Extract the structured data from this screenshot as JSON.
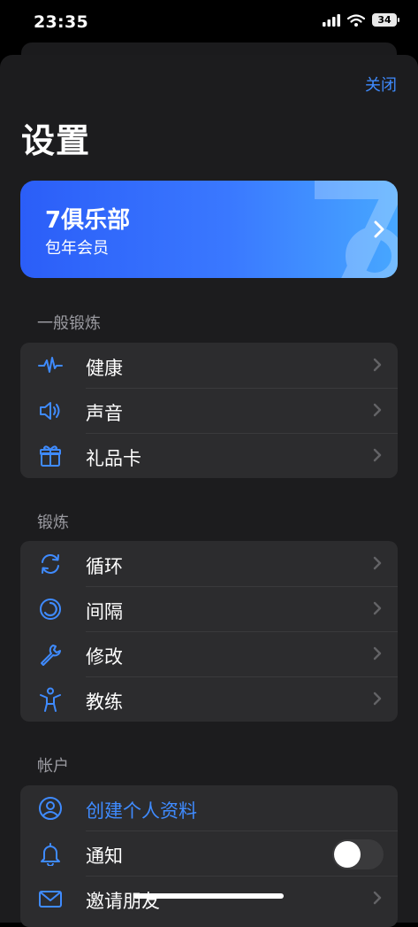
{
  "status": {
    "time": "23:35",
    "battery": "34"
  },
  "header": {
    "close_label": "关闭",
    "title": "设置"
  },
  "club": {
    "title": "7俱乐部",
    "subtitle": "包年会员"
  },
  "sections": {
    "general": {
      "label": "一般锻炼",
      "items": [
        {
          "label": "健康",
          "icon": "heartbeat-icon"
        },
        {
          "label": "声音",
          "icon": "speaker-icon"
        },
        {
          "label": "礼品卡",
          "icon": "gift-icon"
        }
      ]
    },
    "workout": {
      "label": "锻炼",
      "items": [
        {
          "label": "循环",
          "icon": "cycle-icon"
        },
        {
          "label": "间隔",
          "icon": "interval-icon"
        },
        {
          "label": "修改",
          "icon": "wrench-icon"
        },
        {
          "label": "教练",
          "icon": "coach-icon"
        }
      ]
    },
    "account": {
      "label": "帐户",
      "items": [
        {
          "label": "创建个人资料",
          "icon": "profile-icon"
        },
        {
          "label": "通知",
          "icon": "bell-icon",
          "toggle": false
        },
        {
          "label": "邀请朋友",
          "icon": "mail-icon"
        }
      ]
    }
  },
  "colors": {
    "accent": "#3f8bff",
    "background": "#000000",
    "sheet": "#1c1c1e",
    "group": "#2c2c2e"
  }
}
